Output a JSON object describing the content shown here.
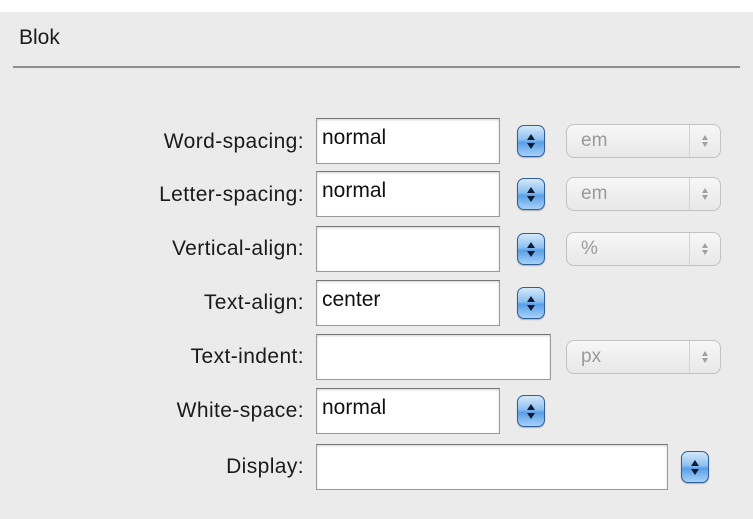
{
  "panel": {
    "title": "Blok"
  },
  "rows": {
    "word_spacing": {
      "label": "Word-spacing:",
      "value": "normal",
      "unit": "em"
    },
    "letter_spacing": {
      "label": "Letter-spacing:",
      "value": "normal",
      "unit": "em"
    },
    "vertical_align": {
      "label": "Vertical-align:",
      "value": "",
      "unit": "%"
    },
    "text_align": {
      "label": "Text-align:",
      "value": "center"
    },
    "text_indent": {
      "label": "Text-indent:",
      "value": "",
      "unit": "px"
    },
    "white_space": {
      "label": "White-space:",
      "value": "normal"
    },
    "display": {
      "label": "Display:",
      "value": ""
    }
  },
  "icons": {
    "stepper": "updown-stepper-icon",
    "unit_arrows": "updown-arrows-icon"
  },
  "colors": {
    "background": "#ebebeb",
    "stepper_blue": "#5a9ee6",
    "unit_text": "#9a9a9a"
  }
}
